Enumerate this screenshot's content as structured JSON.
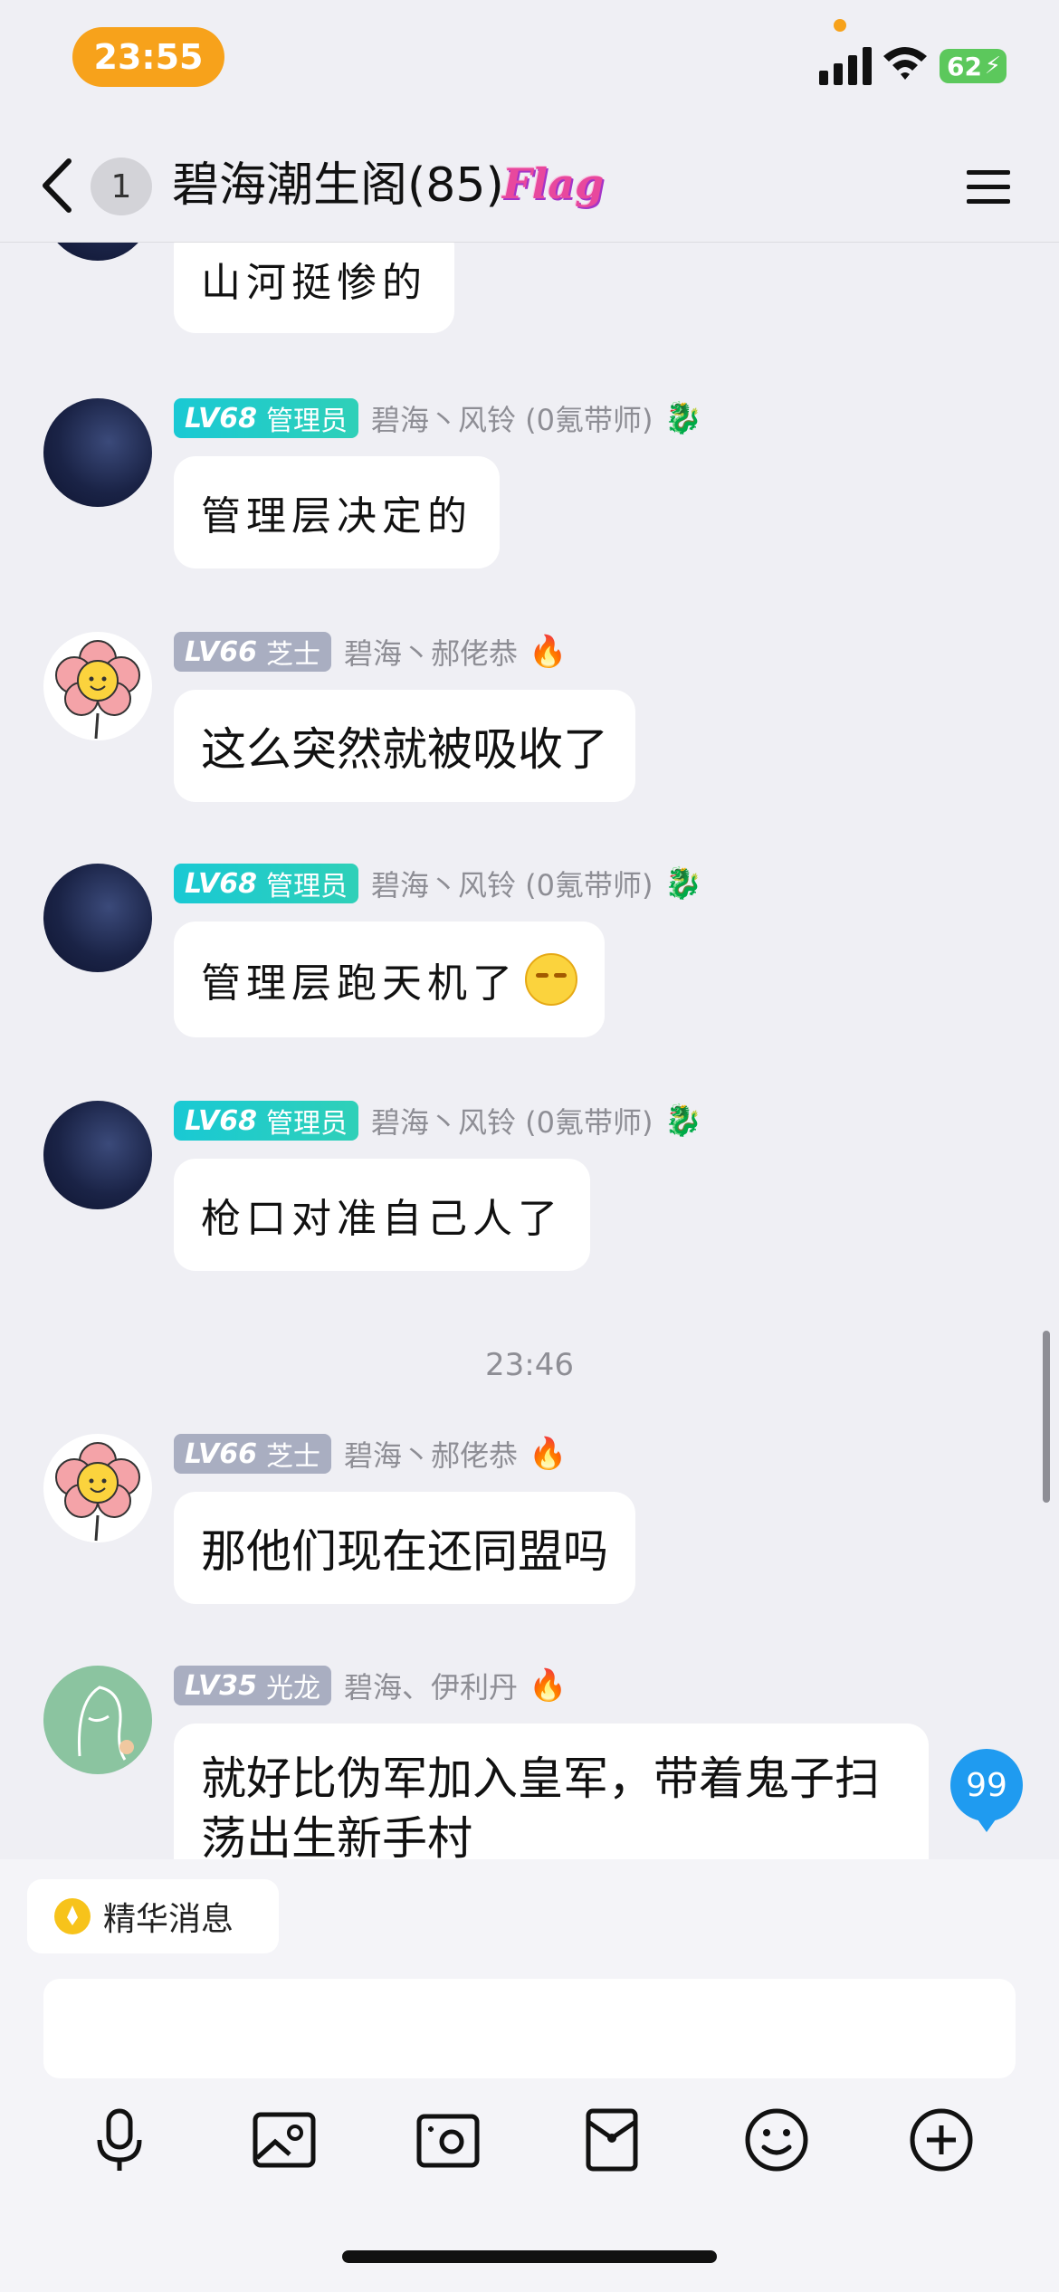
{
  "status_bar": {
    "time": "23:55",
    "battery": "62"
  },
  "header": {
    "unread_count": "1",
    "title": "碧海潮生阁(85)",
    "flag_badge": "Flag"
  },
  "messages": [
    {
      "id": "m0",
      "text": "山河挺惨的",
      "style": "handwriting"
    },
    {
      "id": "m1",
      "level": "LV68",
      "role": "管理员",
      "nickname": "碧海丶风铃 (0氪带师)",
      "text": "管理层决定的",
      "style": "handwriting"
    },
    {
      "id": "m2",
      "level": "LV66",
      "role": "芝士",
      "nickname": "碧海丶郝佬恭",
      "text": "这么突然就被吸收了"
    },
    {
      "id": "m3",
      "level": "LV68",
      "role": "管理员",
      "nickname": "碧海丶风铃 (0氪带师)",
      "text": "管理层跑天机了",
      "style": "handwriting",
      "emoji": "smirk-emoji"
    },
    {
      "id": "m4",
      "level": "LV68",
      "role": "管理员",
      "nickname": "碧海丶风铃 (0氪带师)",
      "text": "枪口对准自己人了",
      "style": "handwriting"
    },
    {
      "id": "m5",
      "level": "LV66",
      "role": "芝士",
      "nickname": "碧海丶郝佬恭",
      "text": "那他们现在还同盟吗"
    },
    {
      "id": "m6",
      "level": "LV35",
      "role": "光龙",
      "nickname": "碧海、伊利丹",
      "text_line1": "就好比伪军加入皇军，带着鬼子扫",
      "text_line2": "荡出生新手村"
    }
  ],
  "timestamp": "23:46",
  "unread_messages_badge": "99",
  "bottom": {
    "essence_label": "精华消息",
    "input_placeholder": ""
  },
  "toolbar_icons": [
    "microphone-icon",
    "image-icon",
    "camera-icon",
    "red-packet-icon",
    "emoji-icon",
    "plus-icon"
  ],
  "colors": {
    "admin_badge": "#19c9d4",
    "member_badge": "#a9aec1",
    "time_pill": "#f7a21b",
    "unread_blue": "#1f9bf0",
    "background": "#efeff4"
  }
}
